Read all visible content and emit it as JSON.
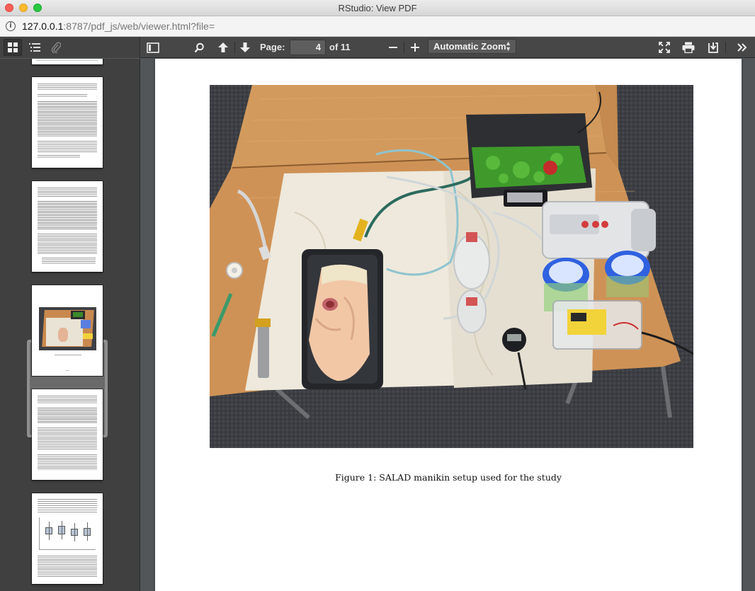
{
  "window": {
    "title": "RStudio: View PDF"
  },
  "address": {
    "host": "127.0.0.1",
    "rest": ":8787/pdf_js/web/viewer.html?file="
  },
  "toolbar": {
    "page_label": "Page:",
    "page_value": "4",
    "page_count": "of 11",
    "zoom": "Automatic Zoom"
  },
  "document": {
    "caption": "Figure 1: SALAD manikin setup used for the study",
    "current_page": 4,
    "total_pages": 11
  },
  "icons": [
    "grid-view-icon",
    "outline-list-icon",
    "attachment-icon",
    "sidebar-toggle-icon",
    "search-icon",
    "previous-page-icon",
    "next-page-icon",
    "zoom-out-icon",
    "zoom-in-icon",
    "presentation-mode-icon",
    "print-icon",
    "download-icon",
    "tools-menu-icon"
  ],
  "colors": {
    "toolbar": "#474747",
    "sidebar": "#404040",
    "viewer_background": "#525659"
  }
}
